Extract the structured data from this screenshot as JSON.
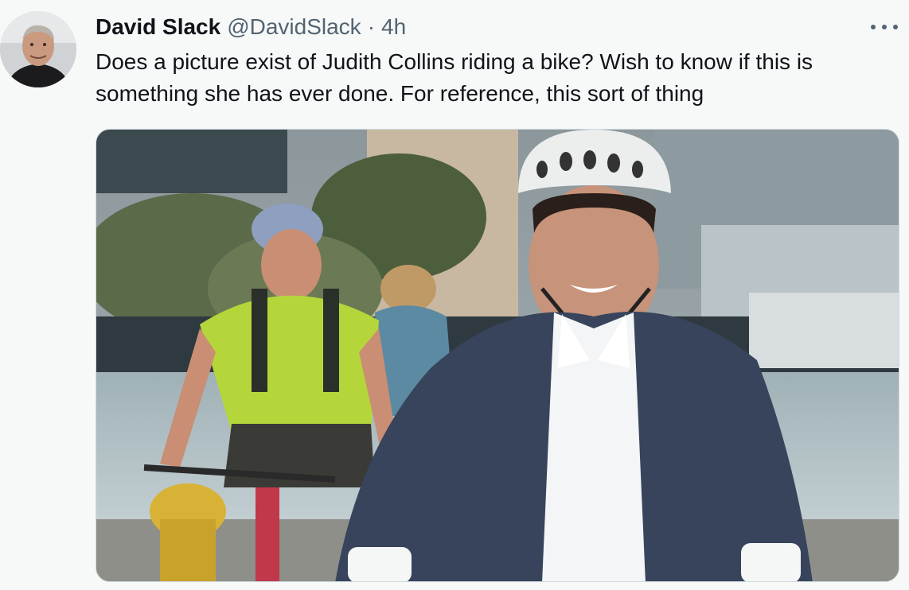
{
  "tweet": {
    "author_name": "David Slack",
    "handle": "@DavidSlack",
    "separator": "·",
    "time": "4h",
    "text_line1": "Does a picture exist of Judith Collins riding a bike? Wish to know if this is",
    "text_line2": "something she has ever done. For reference, this sort of thing",
    "avatar_icon": "avatar-photo",
    "more_icon": "more-horizontal-icon",
    "media_icon": "photo-cyclists"
  },
  "colors": {
    "background": "#f7f9f9",
    "text_primary": "#0f1419",
    "text_secondary": "#536471",
    "media_border": "#cfd9de"
  }
}
